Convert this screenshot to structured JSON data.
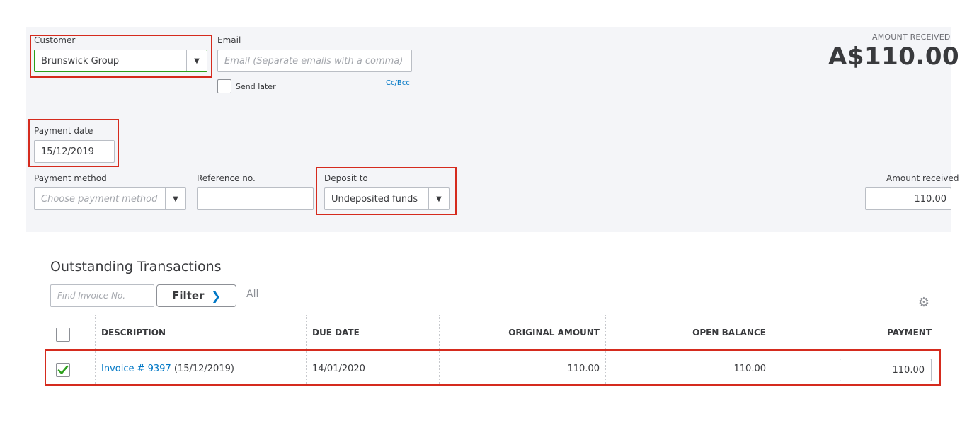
{
  "customer": {
    "label": "Customer",
    "value": "Brunswick Group"
  },
  "email": {
    "label": "Email",
    "placeholder": "Email (Separate emails with a comma)",
    "send_later": "Send later",
    "cc_bcc": "Cc/Bcc"
  },
  "amount_received_header": {
    "label": "AMOUNT RECEIVED",
    "value": "A$110.00"
  },
  "payment_date": {
    "label": "Payment date",
    "value": "15/12/2019"
  },
  "payment_method": {
    "label": "Payment method",
    "placeholder": "Choose payment method"
  },
  "reference": {
    "label": "Reference no.",
    "value": ""
  },
  "deposit_to": {
    "label": "Deposit to",
    "value": "Undeposited funds"
  },
  "amount_received": {
    "label": "Amount received",
    "value": "110.00"
  },
  "outstanding": {
    "title": "Outstanding Transactions",
    "find_placeholder": "Find Invoice No.",
    "filter_label": "Filter",
    "all_label": "All",
    "columns": {
      "description": "DESCRIPTION",
      "due_date": "DUE DATE",
      "original_amount": "ORIGINAL AMOUNT",
      "open_balance": "OPEN BALANCE",
      "payment": "PAYMENT"
    },
    "rows": [
      {
        "checked": true,
        "invoice_link": "Invoice # 9397",
        "invoice_date": "(15/12/2019)",
        "due_date": "14/01/2020",
        "original_amount": "110.00",
        "open_balance": "110.00",
        "payment": "110.00"
      }
    ]
  },
  "colors": {
    "accent_link": "#0077c5",
    "highlight_box": "#d52b1e",
    "check_green": "#2ca01c",
    "panel_bg": "#f4f5f8"
  },
  "icons": {
    "dropdown": "caret-down-icon",
    "filter": "chevron-right-icon",
    "settings": "gear-icon",
    "check": "checkmark-icon"
  }
}
